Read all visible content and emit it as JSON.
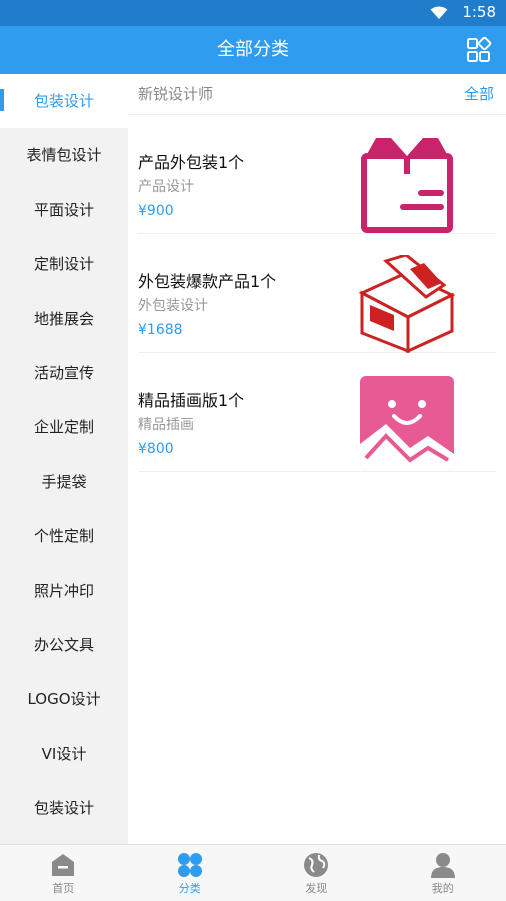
{
  "status": {
    "time": "1:58"
  },
  "header": {
    "title": "全部分类",
    "grid_icon": "grid-apps-icon"
  },
  "sidebar": {
    "items": [
      {
        "label": "包装设计",
        "active": true
      },
      {
        "label": "表情包设计"
      },
      {
        "label": "平面设计"
      },
      {
        "label": "定制设计"
      },
      {
        "label": "地推展会"
      },
      {
        "label": "活动宣传"
      },
      {
        "label": "企业定制"
      },
      {
        "label": "手提袋"
      },
      {
        "label": "个性定制"
      },
      {
        "label": "照片冲印"
      },
      {
        "label": "办公文具"
      },
      {
        "label": "LOGO设计"
      },
      {
        "label": "VI设计"
      },
      {
        "label": "包装设计"
      }
    ]
  },
  "content": {
    "shop_name": "新锐设计师",
    "all_link": "全部",
    "products": [
      {
        "name": "产品外包装1个",
        "category": "产品设计",
        "price": "¥900",
        "icon": "package-box-icon"
      },
      {
        "name": "外包装爆款产品1个",
        "category": "外包装设计",
        "price": "¥1688",
        "icon": "open-box-icon"
      },
      {
        "name": "精品插画版1个",
        "category": "精品插画",
        "price": "¥800",
        "icon": "smiley-picture-icon"
      }
    ]
  },
  "tabbar": {
    "tabs": [
      {
        "label": "首页",
        "icon": "home-icon"
      },
      {
        "label": "分类",
        "icon": "category-icon",
        "active": true
      },
      {
        "label": "发现",
        "icon": "globe-icon"
      },
      {
        "label": "我的",
        "icon": "user-icon"
      }
    ]
  },
  "colors": {
    "primary": "#2f9cf0",
    "statusbar": "#1f7dcc",
    "box_pink": "#c8246c",
    "box_red": "#cc2222",
    "illus_pink": "#e85a94"
  }
}
